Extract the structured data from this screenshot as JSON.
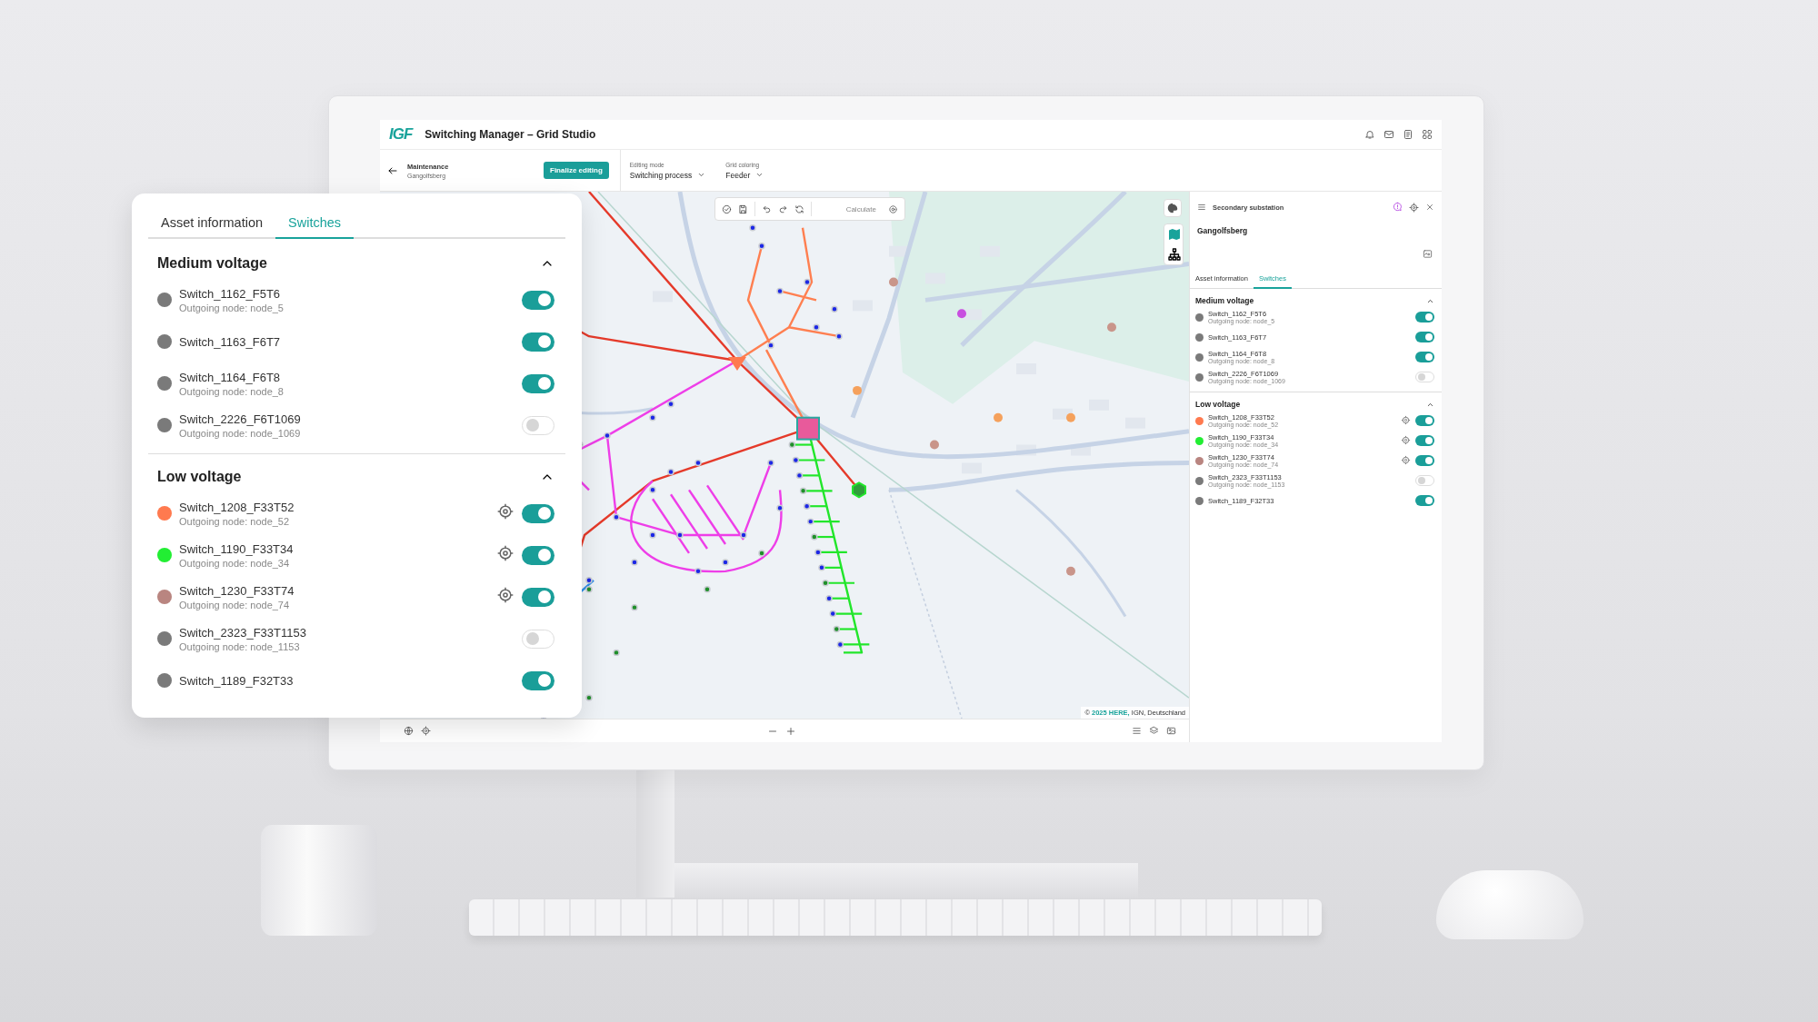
{
  "app": {
    "logo": "IGF",
    "title": "Switching Manager – Grid Studio",
    "context": {
      "label": "Maintenance",
      "value": "Gangolfsberg"
    },
    "finalize_button": "Finalize editing",
    "dropdowns": [
      {
        "label": "Editing mode",
        "value": "Switching process"
      },
      {
        "label": "Grid coloring",
        "value": "Feeder"
      }
    ],
    "map_toolbar": {
      "calculate": "Calculate"
    },
    "attribution": {
      "before": "©",
      "link": "2025 HERE,",
      "after": "IGN, Deutschland"
    },
    "panel": {
      "type": "Secondary substation",
      "name": "Gangolfsberg",
      "tabs": [
        {
          "label": "Asset information",
          "selected": false
        },
        {
          "label": "Switches",
          "selected": true
        }
      ],
      "sections": [
        {
          "title": "Medium voltage",
          "expanded": true,
          "switches": [
            {
              "name": "Switch_1162_F5T6",
              "node": "Outgoing node: node_5",
              "color": "#7a7a7a",
              "on": true,
              "locatable": false
            },
            {
              "name": "Switch_1163_F6T7",
              "color": "#7a7a7a",
              "on": true,
              "locatable": false
            },
            {
              "name": "Switch_1164_F6T8",
              "node": "Outgoing node: node_8",
              "color": "#7a7a7a",
              "on": true,
              "locatable": false
            },
            {
              "name": "Switch_2226_F6T1069",
              "node": "Outgoing node: node_1069",
              "color": "#7a7a7a",
              "on": false,
              "locatable": false
            }
          ]
        },
        {
          "title": "Low voltage",
          "expanded": true,
          "switches": [
            {
              "name": "Switch_1208_F33T52",
              "node": "Outgoing node: node_52",
              "color": "#ff7a4f",
              "on": true,
              "locatable": true
            },
            {
              "name": "Switch_1190_F33T34",
              "node": "Outgoing node: node_34",
              "color": "#22ee33",
              "on": true,
              "locatable": true
            },
            {
              "name": "Switch_1230_F33T74",
              "node": "Outgoing node: node_74",
              "color": "#b98580",
              "on": true,
              "locatable": true
            },
            {
              "name": "Switch_2323_F33T1153",
              "node": "Outgoing node: node_1153",
              "color": "#7a7a7a",
              "on": false,
              "locatable": false
            },
            {
              "name": "Switch_1189_F32T33",
              "color": "#7a7a7a",
              "on": true,
              "locatable": false
            }
          ]
        }
      ]
    }
  },
  "card": {
    "tabs": [
      {
        "label": "Asset information",
        "selected": false
      },
      {
        "label": "Switches",
        "selected": true
      }
    ],
    "sections": [
      {
        "title": "Medium voltage",
        "expanded": true,
        "switches": [
          {
            "name": "Switch_1162_F5T6",
            "node": "Outgoing node: node_5",
            "color": "#7a7a7a",
            "on": true,
            "locatable": false
          },
          {
            "name": "Switch_1163_F6T7",
            "color": "#7a7a7a",
            "on": true,
            "locatable": false
          },
          {
            "name": "Switch_1164_F6T8",
            "node": "Outgoing node: node_8",
            "color": "#7a7a7a",
            "on": true,
            "locatable": false
          },
          {
            "name": "Switch_2226_F6T1069",
            "node": "Outgoing node: node_1069",
            "color": "#7a7a7a",
            "on": false,
            "locatable": false
          }
        ]
      },
      {
        "title": "Low voltage",
        "expanded": true,
        "switches": [
          {
            "name": "Switch_1208_F33T52",
            "node": "Outgoing node: node_52",
            "color": "#ff7a4f",
            "on": true,
            "locatable": true
          },
          {
            "name": "Switch_1190_F33T34",
            "node": "Outgoing node: node_34",
            "color": "#22ee33",
            "on": true,
            "locatable": true
          },
          {
            "name": "Switch_1230_F33T74",
            "node": "Outgoing node: node_74",
            "color": "#b98580",
            "on": true,
            "locatable": true
          },
          {
            "name": "Switch_2323_F33T1153",
            "node": "Outgoing node: node_1153",
            "color": "#7a7a7a",
            "on": false,
            "locatable": false
          },
          {
            "name": "Switch_1189_F32T33",
            "color": "#7a7a7a",
            "on": true,
            "locatable": false
          }
        ]
      }
    ]
  }
}
